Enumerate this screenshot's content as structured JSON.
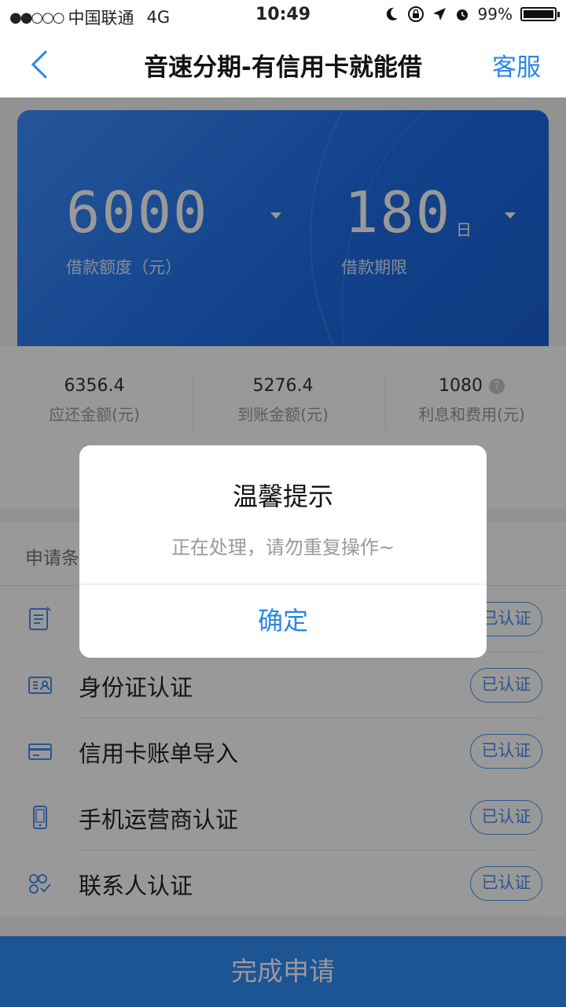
{
  "status_bar": {
    "signal_dots": "●●○○○",
    "carrier": "中国联通",
    "network": "4G",
    "time": "10:49",
    "battery": "99%",
    "battery_level": 0.99
  },
  "nav": {
    "title": "音速分期-有信用卡就能借",
    "service_label": "客服"
  },
  "loan": {
    "amount": "6000",
    "amount_label": "借款额度（元）",
    "term": "180",
    "term_unit": "日",
    "term_label": "借款期限"
  },
  "summary": [
    {
      "value": "6356.4",
      "label": "应还金额(元)"
    },
    {
      "value": "5276.4",
      "label": "到账金额(元)"
    },
    {
      "value": "1080",
      "label": "利息和费用(元)",
      "help_icon": "?"
    }
  ],
  "conditions": {
    "header": "申请条",
    "items": [
      {
        "label": "",
        "status": "已认证",
        "icon": "document-edit-icon"
      },
      {
        "label": "身份证认证",
        "status": "已认证",
        "icon": "id-card-icon"
      },
      {
        "label": "信用卡账单导入",
        "status": "已认证",
        "icon": "credit-card-icon"
      },
      {
        "label": "手机运营商认证",
        "status": "已认证",
        "icon": "phone-icon"
      },
      {
        "label": "联系人认证",
        "status": "已认证",
        "icon": "contacts-icon"
      }
    ]
  },
  "bottom_button": "完成申请",
  "dialog": {
    "title": "温馨提示",
    "message": "正在处理，请勿重复操作~",
    "confirm": "确定"
  },
  "colors": {
    "accent": "#2a86e8",
    "hero_blue": "#1f6fe8",
    "button_blue": "#2f8cf7"
  }
}
